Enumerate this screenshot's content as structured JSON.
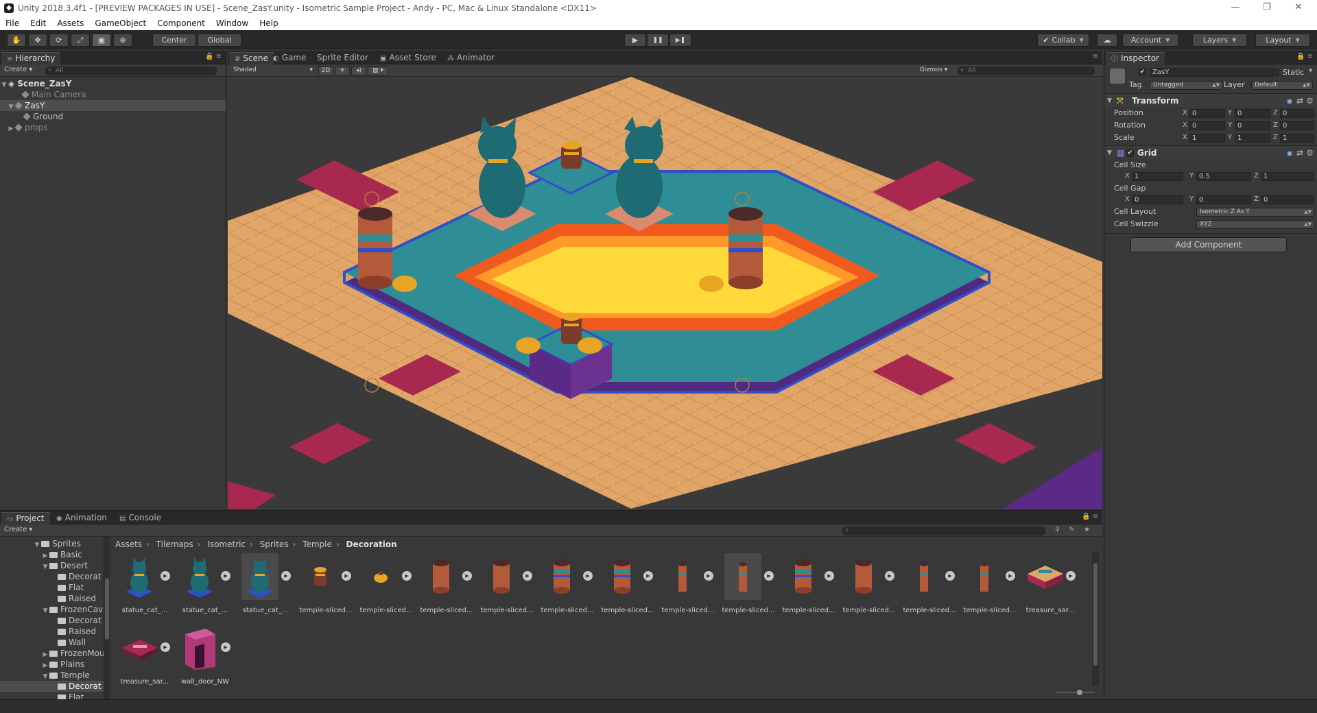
{
  "window": {
    "title": "Unity 2018.3.4f1 - [PREVIEW PACKAGES IN USE] - Scene_ZasY.unity - Isometric Sample Project - Andy - PC, Mac & Linux Standalone <DX11>",
    "minimize": "—",
    "maximize": "❐",
    "close": "✕"
  },
  "menu": [
    "File",
    "Edit",
    "Assets",
    "GameObject",
    "Component",
    "Window",
    "Help"
  ],
  "toolbar": {
    "tools": [
      "hand-icon",
      "move-icon",
      "rotate-icon",
      "scale-icon",
      "rect-icon",
      "transform-icon"
    ],
    "tool_glyphs": [
      "✋",
      "✥",
      "⟳",
      "⤢",
      "▣",
      "⊕"
    ],
    "pivot": "Center",
    "space": "Global",
    "play": "▶",
    "pause": "❚❚",
    "step": "▶❚",
    "collab": "Collab",
    "account": "Account",
    "layers": "Layers",
    "layout": "Layout"
  },
  "hierarchy": {
    "tab": "Hierarchy",
    "create": "Create",
    "search_placeholder": "All",
    "scene": "Scene_ZasY",
    "items": [
      "Main Camera",
      "ZasY",
      "Ground",
      "props"
    ]
  },
  "scene_view": {
    "tabs": [
      "Scene",
      "Game",
      "Sprite Editor",
      "Asset Store",
      "Animator"
    ],
    "shading": "Shaded",
    "mode_2d": "2D",
    "gizmos": "Gizmos",
    "search_placeholder": "All"
  },
  "inspector": {
    "tab": "Inspector",
    "object_name": "ZasY",
    "static_label": "Static",
    "tag_label": "Tag",
    "tag_value": "Untagged",
    "layer_label": "Layer",
    "layer_value": "Default",
    "transform": {
      "title": "Transform",
      "rows": [
        {
          "label": "Position",
          "x": "0",
          "y": "0",
          "z": "0"
        },
        {
          "label": "Rotation",
          "x": "0",
          "y": "0",
          "z": "0"
        },
        {
          "label": "Scale",
          "x": "1",
          "y": "1",
          "z": "1"
        }
      ]
    },
    "grid": {
      "title": "Grid",
      "cell_size_label": "Cell Size",
      "cell_size": {
        "x": "1",
        "y": "0.5",
        "z": "1"
      },
      "cell_gap_label": "Cell Gap",
      "cell_gap": {
        "x": "0",
        "y": "0",
        "z": "0"
      },
      "cell_layout_label": "Cell Layout",
      "cell_layout_value": "Isometric Z As Y",
      "cell_swizzle_label": "Cell Swizzle",
      "cell_swizzle_value": "XYZ"
    },
    "add_component": "Add Component",
    "axes": [
      "X",
      "Y",
      "Z"
    ]
  },
  "project": {
    "tabs": [
      "Project",
      "Animation",
      "Console"
    ],
    "create": "Create",
    "tree": [
      {
        "label": "Sprites",
        "depth": 0,
        "open": true
      },
      {
        "label": "Basic",
        "depth": 1,
        "open": false
      },
      {
        "label": "Desert",
        "depth": 1,
        "open": true
      },
      {
        "label": "Decorat",
        "depth": 2
      },
      {
        "label": "Flat",
        "depth": 2
      },
      {
        "label": "Raised",
        "depth": 2
      },
      {
        "label": "FrozenCav",
        "depth": 1,
        "open": true
      },
      {
        "label": "Decorat",
        "depth": 2
      },
      {
        "label": "Raised",
        "depth": 2
      },
      {
        "label": "Wall",
        "depth": 2
      },
      {
        "label": "FrozenMou",
        "depth": 1,
        "open": false
      },
      {
        "label": "Plains",
        "depth": 1,
        "open": false
      },
      {
        "label": "Temple",
        "depth": 1,
        "open": true
      },
      {
        "label": "Decorat",
        "depth": 2,
        "selected": true
      },
      {
        "label": "Flat",
        "depth": 2
      }
    ],
    "breadcrumb": [
      "Assets",
      "Tilemaps",
      "Isometric",
      "Sprites",
      "Temple",
      "Decoration"
    ],
    "assets": [
      {
        "label": "statue_cat_...",
        "kind": "cat"
      },
      {
        "label": "statue_cat_...",
        "kind": "cat"
      },
      {
        "label": "statue_cat_...",
        "kind": "cat",
        "selected": true
      },
      {
        "label": "temple-sliced...",
        "kind": "urn"
      },
      {
        "label": "temple-sliced...",
        "kind": "urn-small"
      },
      {
        "label": "temple-sliced...",
        "kind": "pillar"
      },
      {
        "label": "temple-sliced...",
        "kind": "pillar"
      },
      {
        "label": "temple-sliced...",
        "kind": "pillar-band"
      },
      {
        "label": "temple-sliced...",
        "kind": "pillar-band"
      },
      {
        "label": "temple-sliced...",
        "kind": "post"
      },
      {
        "label": "temple-sliced...",
        "kind": "post",
        "selected": true
      },
      {
        "label": "temple-sliced...",
        "kind": "pillar-band"
      },
      {
        "label": "temple-sliced...",
        "kind": "pillar"
      },
      {
        "label": "temple-sliced...",
        "kind": "post"
      },
      {
        "label": "temple-sliced...",
        "kind": "post"
      },
      {
        "label": "treasure_sar...",
        "kind": "chest"
      },
      {
        "label": "treasure_sar...",
        "kind": "chest-flat"
      },
      {
        "label": "wall_door_NW",
        "kind": "door"
      }
    ]
  },
  "colors": {
    "sand": "#e0a567",
    "sand_line": "#c88a52",
    "crimson": "#a8284f",
    "teal": "#2f8e95",
    "blue_edge": "#2e4fc9",
    "purple": "#5a2a86",
    "lava": "#ffd83a",
    "lava_edge": "#f05a1e"
  }
}
